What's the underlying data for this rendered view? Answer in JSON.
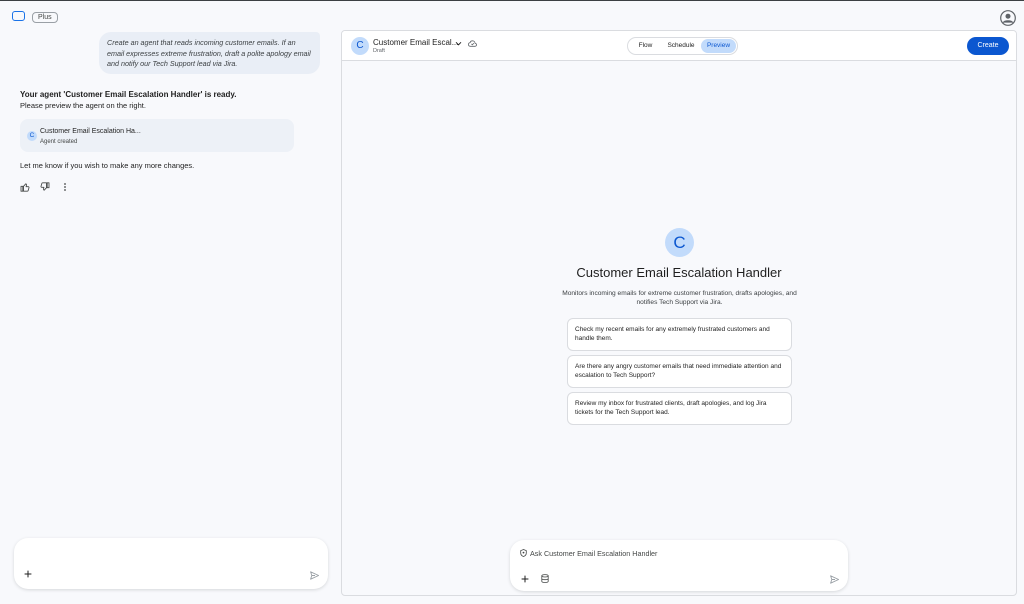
{
  "topbar": {
    "plan_badge": "Plus",
    "logo_icon": "app-logo-icon",
    "account_icon": "account-circle-icon"
  },
  "chat": {
    "user_message": "Create an agent that reads incoming customer emails. If an email expresses extreme frustration, draft a polite apology email and notify our Tech Support lead via Jira.",
    "reply_title": "Your agent 'Customer Email Escalation Handler' is ready.",
    "reply_subtitle": "Please preview the agent on the right.",
    "agent_card": {
      "avatar_letter": "C",
      "name": "Customer Email Escalation Ha...",
      "status": "Agent created"
    },
    "followup": "Let me know if you wish to make any more changes.",
    "feedback_icons": [
      "thumb-up-icon",
      "thumb-down-icon",
      "more-vert-icon"
    ],
    "input_icons": [
      "add-icon",
      "send-icon"
    ]
  },
  "panel": {
    "header": {
      "avatar_letter": "C",
      "title": "Customer Email Escal...",
      "status": "Draft",
      "tabs": [
        "Flow",
        "Schedule",
        "Preview"
      ],
      "active_tab": "Preview",
      "create_label": "Create"
    },
    "preview": {
      "avatar_letter": "C",
      "title": "Customer Email Escalation Handler",
      "description": "Monitors incoming emails for extreme customer frustration, drafts apologies, and notifies Tech Support via Jira.",
      "suggestions": [
        "Check my recent emails for any extremely frustrated customers and handle them.",
        "Are there any angry customer emails that need immediate attention and escalation to Tech Support?",
        "Review my inbox for frustrated clients, draft apologies, and log Jira tickets for the Tech Support lead."
      ],
      "input_placeholder": "Ask Customer Email Escalation Handler"
    }
  },
  "colors": {
    "accent": "#0b57d0",
    "avatar_bg": "#c2dbfb",
    "user_bubble": "#e9eef6",
    "page_bg": "#f8f9fc"
  }
}
